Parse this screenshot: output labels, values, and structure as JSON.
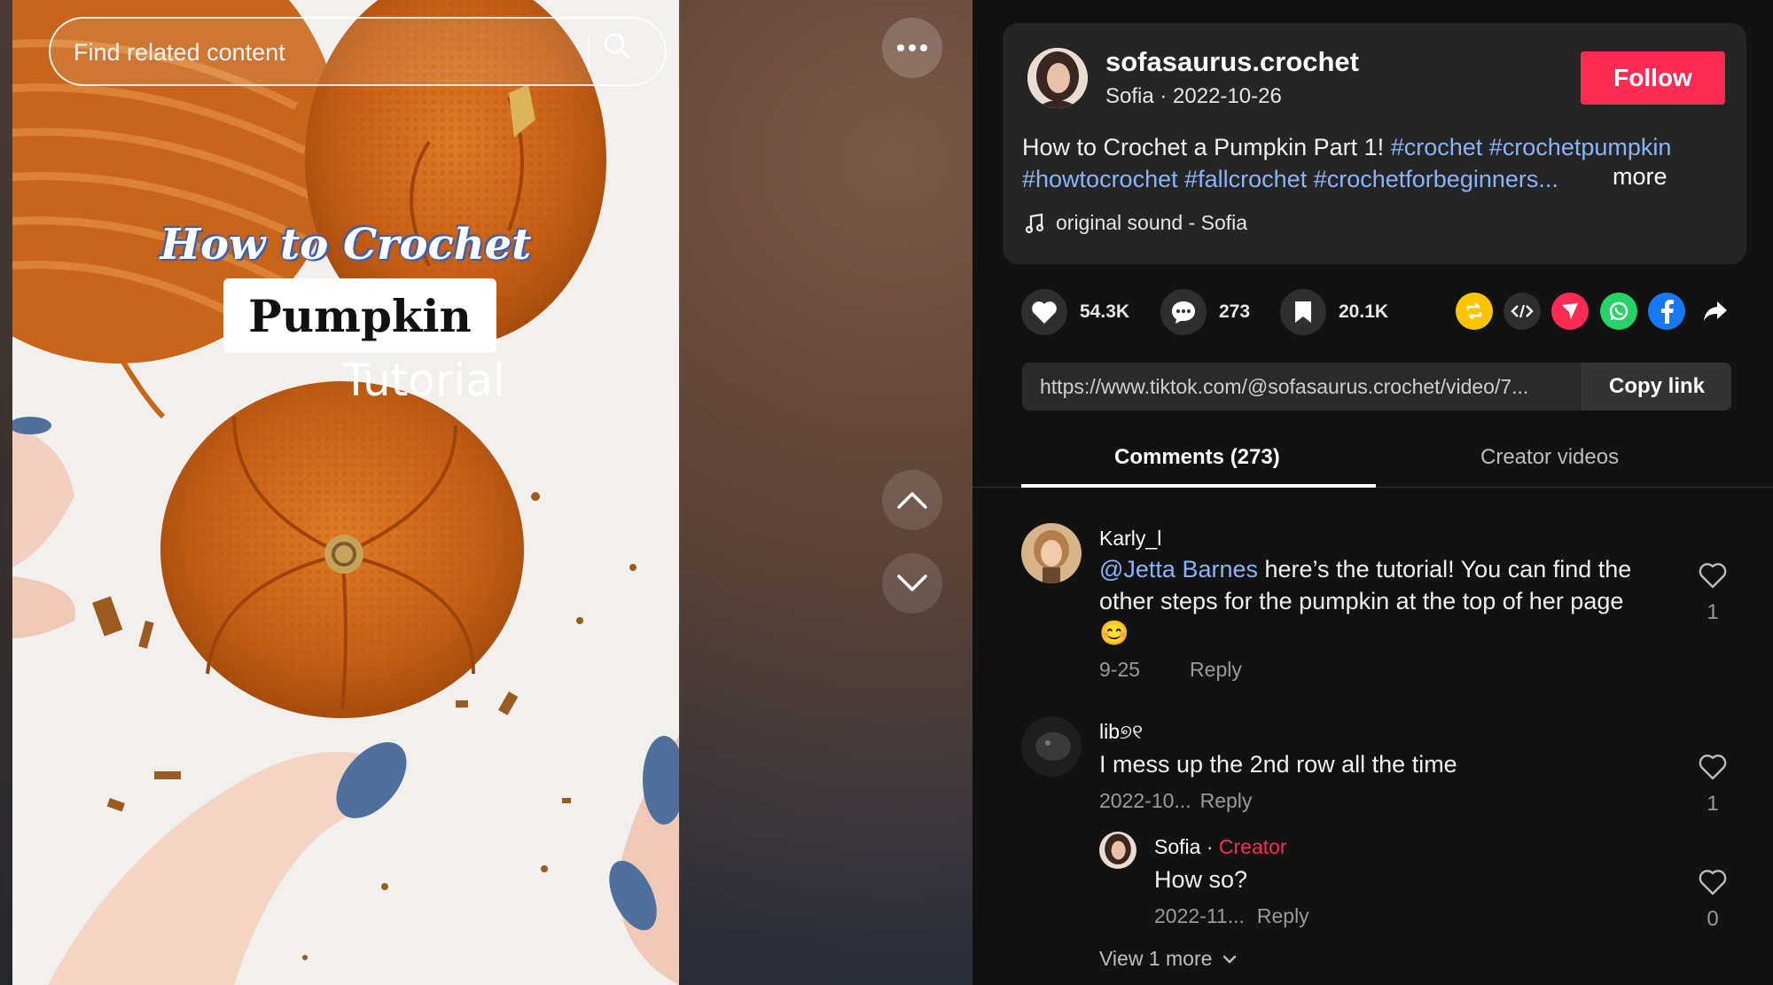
{
  "search": {
    "placeholder": "Find related content"
  },
  "video_overlay": {
    "line1": "How to Crochet",
    "line2": "Pumpkin",
    "line3": "Tutorial"
  },
  "author": {
    "username": "sofasaurus.crochet",
    "display_name": "Sofia",
    "date": "2022-10-26",
    "follow_label": "Follow"
  },
  "description": {
    "text": "How to Crochet a Pumpkin Part 1!",
    "hashtags_line1": [
      "#crochet",
      "#crochetpumpkin"
    ],
    "hashtags_line2": [
      "#howtocrochet",
      "#fallcrochet",
      "#crochetforbeginners"
    ],
    "ellipsis": "...",
    "more_label": "more"
  },
  "sound": {
    "label": "original sound - Sofia",
    "icon": "music-note-icon"
  },
  "stats": {
    "likes": "54.3K",
    "comments": "273",
    "saves": "20.1K"
  },
  "share": {
    "icons": [
      "repost-icon",
      "embed-icon",
      "send-icon",
      "whatsapp-icon",
      "facebook-icon",
      "share-icon"
    ]
  },
  "link": {
    "url": "https://www.tiktok.com/@sofasaurus.crochet/video/7...",
    "copy_label": "Copy link"
  },
  "tabs": [
    {
      "label": "Comments (273)",
      "active": true
    },
    {
      "label": "Creator videos",
      "active": false
    }
  ],
  "comments": [
    {
      "user": "Karly_l",
      "mention": "@Jetta Barnes",
      "text": " here’s the tutorial! You can find the other steps for the pumpkin at the top of her page",
      "emoji": "😊",
      "date": "9-25",
      "reply_label": "Reply",
      "likes": "1"
    },
    {
      "user": "lib୭୧",
      "text": "I mess up the 2nd row all the time",
      "date": "2022-10...",
      "reply_label": "Reply",
      "likes": "1",
      "replies": [
        {
          "user": "Sofia",
          "separator": " · ",
          "badge": "Creator",
          "text": "How so?",
          "date": "2022-11...",
          "reply_label": "Reply",
          "likes": "0"
        }
      ],
      "view_more_label": "View 1 more"
    }
  ],
  "colors": {
    "accent": "#fe2c55",
    "hashtag": "#8ab4f8",
    "background": "#121212",
    "card": "#252525",
    "pumpkin": "#d2691e"
  }
}
